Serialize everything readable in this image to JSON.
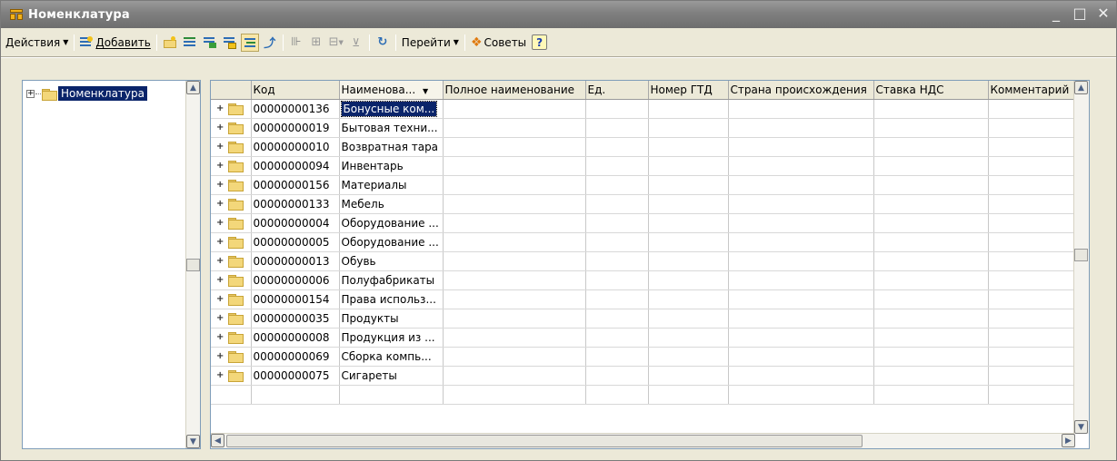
{
  "window": {
    "title": "Номенклатура",
    "controls": {
      "minimize": "_",
      "maximize": "□",
      "close": "✕"
    }
  },
  "toolbar": {
    "actions_label": "Действия",
    "add_label": "Добавить",
    "goto_label": "Перейти",
    "tips_label": "Советы",
    "help_label": "?"
  },
  "tree": {
    "root_label": "Номенклатура",
    "expander": "+"
  },
  "grid": {
    "columns": [
      "Код",
      "Наименова...",
      "Полное наименование",
      "Ед.",
      "Номер ГТД",
      "Страна происхождения",
      "Ставка НДС",
      "Комментарий"
    ],
    "sort_indicator": "▼",
    "rows": [
      {
        "code": "00000000136",
        "name": "Бонусные ком..."
      },
      {
        "code": "00000000019",
        "name": "Бытовая техни..."
      },
      {
        "code": "00000000010",
        "name": "Возвратная тара"
      },
      {
        "code": "00000000094",
        "name": "Инвентарь"
      },
      {
        "code": "00000000156",
        "name": "Материалы"
      },
      {
        "code": "00000000133",
        "name": "Мебель"
      },
      {
        "code": "00000000004",
        "name": "Оборудование ..."
      },
      {
        "code": "00000000005",
        "name": "Оборудование ..."
      },
      {
        "code": "00000000013",
        "name": "Обувь"
      },
      {
        "code": "00000000006",
        "name": "Полуфабрикаты"
      },
      {
        "code": "00000000154",
        "name": "Права использ..."
      },
      {
        "code": "00000000035",
        "name": "Продукты"
      },
      {
        "code": "00000000008",
        "name": "Продукция из ..."
      },
      {
        "code": "00000000069",
        "name": "Сборка компь..."
      },
      {
        "code": "00000000075",
        "name": "Сигареты"
      }
    ]
  },
  "colors": {
    "selection": "#0a246a",
    "titlebar": "#7f7f7f",
    "folder": "#f3d77a"
  }
}
